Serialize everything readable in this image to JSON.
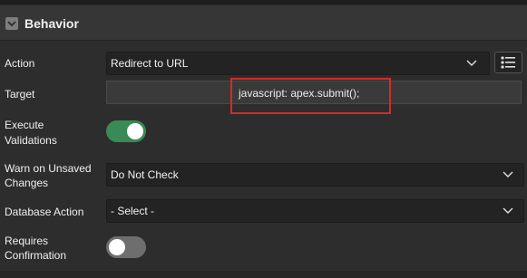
{
  "section": {
    "title": "Behavior",
    "icon": "chevron-collapse-icon"
  },
  "fields": {
    "action": {
      "label": "Action",
      "value": "Redirect to URL"
    },
    "target": {
      "label": "Target",
      "value": "javascript: apex.submit();"
    },
    "execute_validations": {
      "label_line1": "Execute",
      "label_line2": "Validations",
      "state": "on"
    },
    "warn_unsaved": {
      "label_line1": "Warn on Unsaved",
      "label_line2": "Changes",
      "value": "Do Not Check"
    },
    "database_action": {
      "label": "Database Action",
      "value": "- Select -"
    },
    "requires_confirmation": {
      "label_line1": "Requires",
      "label_line2": "Confirmation",
      "state": "off"
    }
  },
  "colors": {
    "toggle_on": "#3a8a55",
    "toggle_off": "#6e6e6e",
    "highlight": "#d42a2a"
  }
}
